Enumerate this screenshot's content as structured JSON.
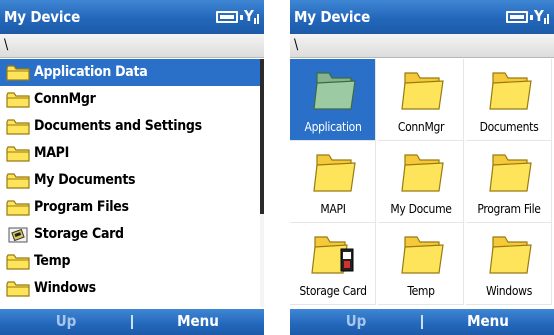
{
  "list_screen": {
    "title": "My Device",
    "path": "\\",
    "items": [
      {
        "label": "Application Data",
        "icon": "folder-icon",
        "selected": true
      },
      {
        "label": "ConnMgr",
        "icon": "folder-icon"
      },
      {
        "label": "Documents and Settings",
        "icon": "folder-icon"
      },
      {
        "label": "MAPI",
        "icon": "folder-icon"
      },
      {
        "label": "My Documents",
        "icon": "folder-icon"
      },
      {
        "label": "Program Files",
        "icon": "folder-icon"
      },
      {
        "label": "Storage Card",
        "icon": "storage-card-icon"
      },
      {
        "label": "Temp",
        "icon": "folder-icon"
      },
      {
        "label": "Windows",
        "icon": "folder-icon"
      }
    ],
    "softkeys": {
      "left": "Up",
      "right": "Menu"
    }
  },
  "grid_screen": {
    "title": "My Device",
    "path": "\\",
    "items": [
      {
        "label": "Application",
        "icon": "folder-icon",
        "selected": true
      },
      {
        "label": "ConnMgr",
        "icon": "folder-icon"
      },
      {
        "label": "Documents",
        "icon": "folder-icon"
      },
      {
        "label": "MAPI",
        "icon": "folder-icon"
      },
      {
        "label": "My Docume",
        "icon": "folder-icon"
      },
      {
        "label": "Program File",
        "icon": "folder-icon"
      },
      {
        "label": "Storage Card",
        "icon": "storage-card-icon"
      },
      {
        "label": "Temp",
        "icon": "folder-icon"
      },
      {
        "label": "Windows",
        "icon": "folder-icon"
      }
    ],
    "softkeys": {
      "left": "Up",
      "right": "Menu"
    }
  },
  "colors": {
    "title_bar": "#2367bb",
    "selection": "#2a70c8",
    "folder_fill": "#fde45a",
    "folder_outline": "#9a7a10"
  }
}
